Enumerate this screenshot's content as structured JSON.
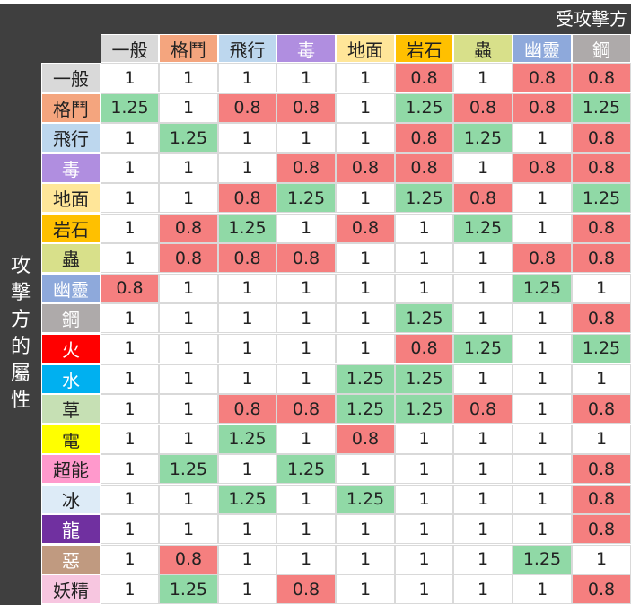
{
  "defending_title": "受攻擊方",
  "attacking_title": "攻擊方的屬性",
  "columns": [
    {
      "label": "一般",
      "bg": "#d9d9d9",
      "fg": "#222222"
    },
    {
      "label": "格鬥",
      "bg": "#f4a57e",
      "fg": "#222222"
    },
    {
      "label": "飛行",
      "bg": "#bdd7ee",
      "fg": "#222222"
    },
    {
      "label": "毒",
      "bg": "#b08ee0",
      "fg": "#ffffff"
    },
    {
      "label": "地面",
      "bg": "#ffe699",
      "fg": "#222222"
    },
    {
      "label": "岩石",
      "bg": "#ffc000",
      "fg": "#222222"
    },
    {
      "label": "蟲",
      "bg": "#d8e08a",
      "fg": "#222222"
    },
    {
      "label": "幽靈",
      "bg": "#8ea9db",
      "fg": "#ffffff"
    },
    {
      "label": "鋼",
      "bg": "#aeaaaa",
      "fg": "#ffffff"
    }
  ],
  "rows": [
    {
      "label": "一般",
      "bg": "#d9d9d9",
      "fg": "#222222",
      "values": [
        "1",
        "1",
        "1",
        "1",
        "1",
        "0.8",
        "1",
        "0.8",
        "0.8"
      ]
    },
    {
      "label": "格鬥",
      "bg": "#f4a57e",
      "fg": "#222222",
      "values": [
        "1.25",
        "1",
        "0.8",
        "0.8",
        "1",
        "1.25",
        "0.8",
        "0.8",
        "1.25"
      ]
    },
    {
      "label": "飛行",
      "bg": "#bdd7ee",
      "fg": "#222222",
      "values": [
        "1",
        "1.25",
        "1",
        "1",
        "1",
        "0.8",
        "1.25",
        "1",
        "0.8"
      ]
    },
    {
      "label": "毒",
      "bg": "#b08ee0",
      "fg": "#ffffff",
      "values": [
        "1",
        "1",
        "1",
        "0.8",
        "0.8",
        "0.8",
        "1",
        "0.8",
        "0.8"
      ]
    },
    {
      "label": "地面",
      "bg": "#ffe699",
      "fg": "#222222",
      "values": [
        "1",
        "1",
        "0.8",
        "1.25",
        "1",
        "1.25",
        "0.8",
        "1",
        "1.25"
      ]
    },
    {
      "label": "岩石",
      "bg": "#ffc000",
      "fg": "#222222",
      "values": [
        "1",
        "0.8",
        "1.25",
        "1",
        "0.8",
        "1",
        "1.25",
        "1",
        "0.8"
      ]
    },
    {
      "label": "蟲",
      "bg": "#d8e08a",
      "fg": "#222222",
      "values": [
        "1",
        "0.8",
        "0.8",
        "0.8",
        "1",
        "1",
        "1",
        "0.8",
        "0.8"
      ]
    },
    {
      "label": "幽靈",
      "bg": "#8ea9db",
      "fg": "#ffffff",
      "values": [
        "0.8",
        "1",
        "1",
        "1",
        "1",
        "1",
        "1",
        "1.25",
        "1"
      ]
    },
    {
      "label": "鋼",
      "bg": "#aeaaaa",
      "fg": "#ffffff",
      "values": [
        "1",
        "1",
        "1",
        "1",
        "1",
        "1.25",
        "1",
        "1",
        "0.8"
      ]
    },
    {
      "label": "火",
      "bg": "#ff0000",
      "fg": "#ffffff",
      "values": [
        "1",
        "1",
        "1",
        "1",
        "1",
        "0.8",
        "1.25",
        "1",
        "1.25"
      ]
    },
    {
      "label": "水",
      "bg": "#00b0f0",
      "fg": "#ffffff",
      "values": [
        "1",
        "1",
        "1",
        "1",
        "1.25",
        "1.25",
        "1",
        "1",
        "1"
      ]
    },
    {
      "label": "草",
      "bg": "#c6e0b4",
      "fg": "#222222",
      "values": [
        "1",
        "1",
        "0.8",
        "0.8",
        "1.25",
        "1.25",
        "0.8",
        "1",
        "0.8"
      ]
    },
    {
      "label": "電",
      "bg": "#ffff00",
      "fg": "#222222",
      "values": [
        "1",
        "1",
        "1.25",
        "1",
        "0.8",
        "1",
        "1",
        "1",
        "1"
      ]
    },
    {
      "label": "超能",
      "bg": "#ff99cc",
      "fg": "#222222",
      "values": [
        "1",
        "1.25",
        "1",
        "1.25",
        "1",
        "1",
        "1",
        "1",
        "0.8"
      ]
    },
    {
      "label": "冰",
      "bg": "#ddebf7",
      "fg": "#222222",
      "values": [
        "1",
        "1",
        "1.25",
        "1",
        "1.25",
        "1",
        "1",
        "1",
        "0.8"
      ]
    },
    {
      "label": "龍",
      "bg": "#7030a0",
      "fg": "#ffffff",
      "values": [
        "1",
        "1",
        "1",
        "1",
        "1",
        "1",
        "1",
        "1",
        "0.8"
      ]
    },
    {
      "label": "惡",
      "bg": "#c09a80",
      "fg": "#ffffff",
      "values": [
        "1",
        "0.8",
        "1",
        "1",
        "1",
        "1",
        "1",
        "1.25",
        "1"
      ]
    },
    {
      "label": "妖精",
      "bg": "#f7c6e0",
      "fg": "#222222",
      "values": [
        "1",
        "1.25",
        "1",
        "0.8",
        "1",
        "1",
        "1",
        "1",
        "0.8"
      ]
    }
  ],
  "value_colors": {
    "1.25": "#90d9a6",
    "0.8": "#f57f7f",
    "1": "#ffffff"
  }
}
